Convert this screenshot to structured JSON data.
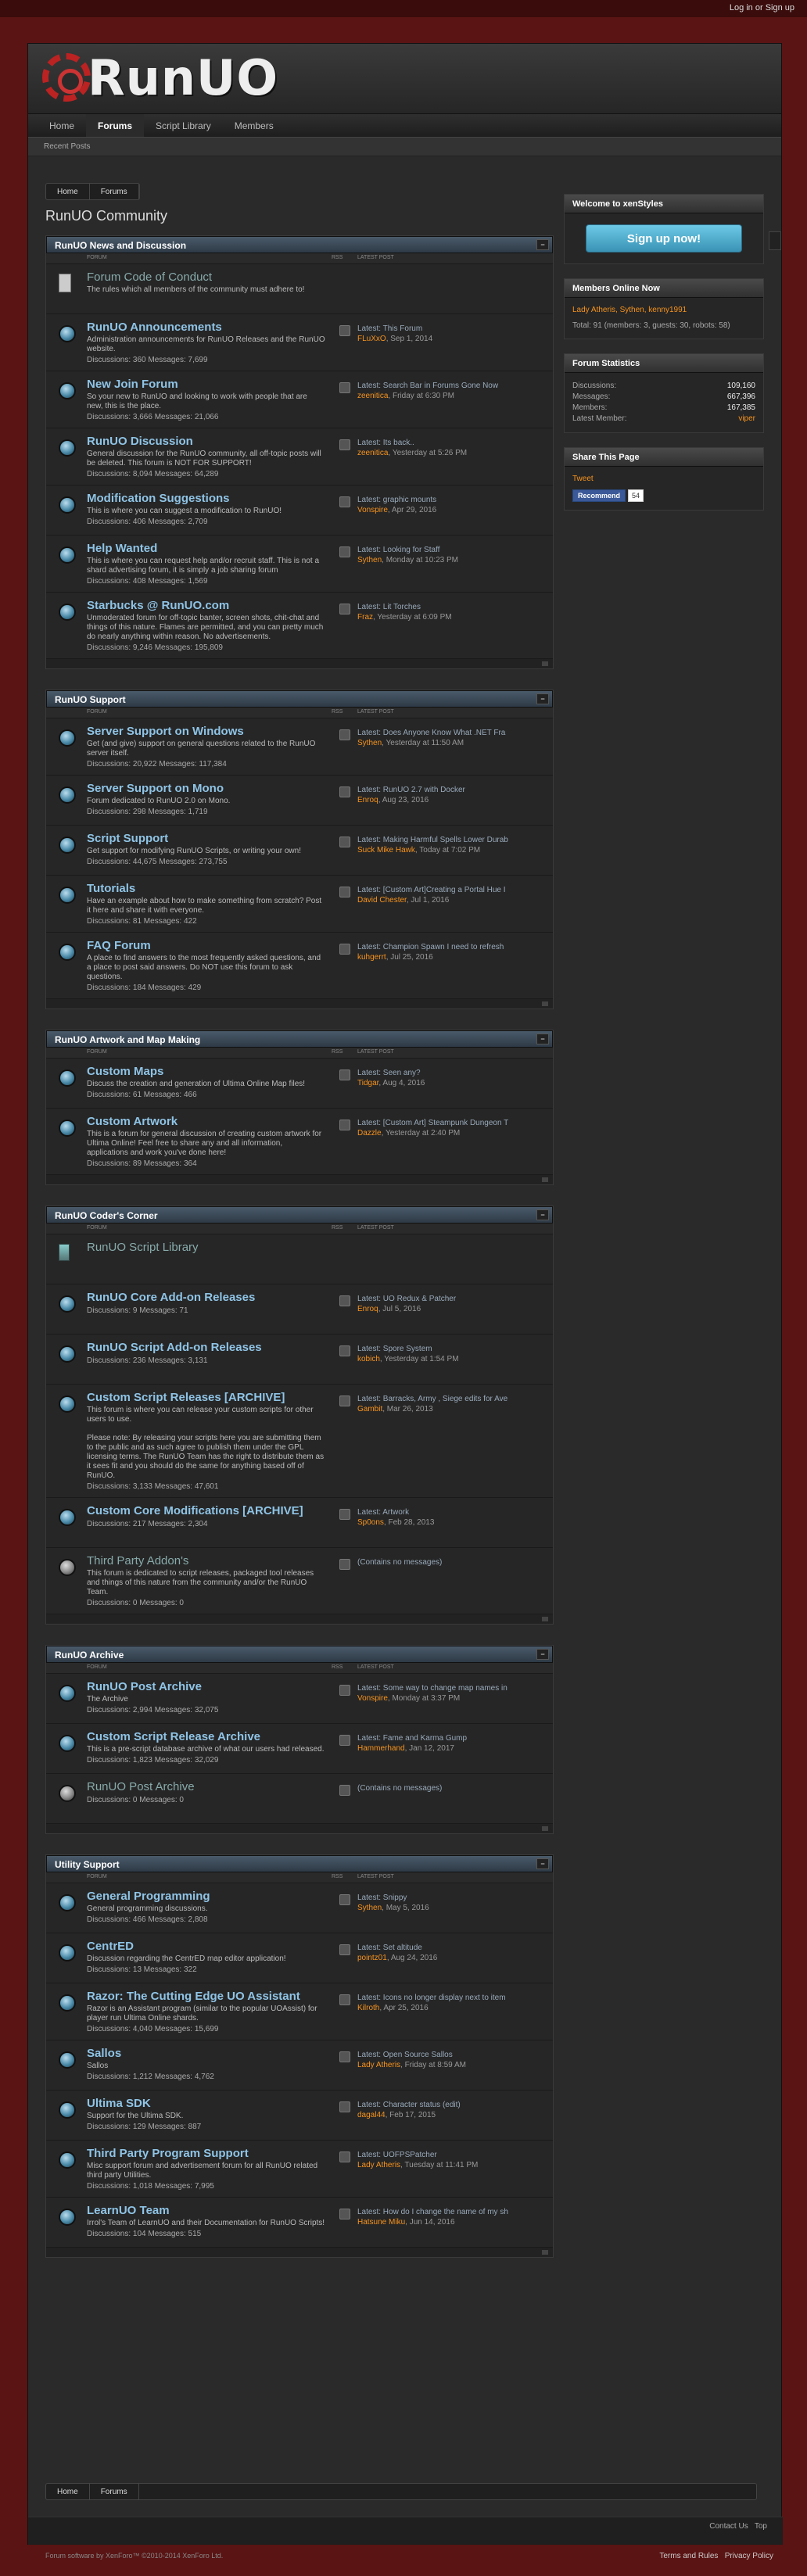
{
  "topbar": {
    "login": "Log in or Sign up"
  },
  "logo": "RunUO",
  "nav": {
    "home": "Home",
    "forums": "Forums",
    "scripts": "Script Library",
    "members": "Members"
  },
  "subnav": "Recent Posts",
  "breadcrumb": {
    "home": "Home",
    "forums": "Forums"
  },
  "page_title": "RunUO Community",
  "col": {
    "forum": "FORUM",
    "rss": "RSS",
    "latest": "LATEST POST"
  },
  "cats": [
    {
      "title": "RunUO News and Discussion",
      "forums": [
        {
          "kind": "doc",
          "name": "Forum Code of Conduct",
          "desc": "The rules which all members of the community must adhere to!",
          "stats": "",
          "latest": "",
          "user": "",
          "time": ""
        },
        {
          "kind": "ic",
          "name": "RunUO Announcements",
          "desc": "Administration announcements for RunUO Releases and the RunUO website.",
          "stats": "Discussions: 360 Messages: 7,699",
          "latest": "Latest: This Forum",
          "user": "FLuXxO",
          "time": ", Sep 1, 2014"
        },
        {
          "kind": "ic",
          "name": "New Join Forum",
          "desc": "So your new to RunUO and looking to work with people that are new, this is the place.",
          "stats": "Discussions: 3,666 Messages: 21,066",
          "latest": "Latest: Search Bar in Forums Gone Now",
          "user": "zeenitica",
          "time": ", Friday at 6:30 PM"
        },
        {
          "kind": "ic",
          "name": "RunUO Discussion",
          "desc": "General discussion for the RunUO community, all off-topic posts will be deleted. This forum is NOT FOR SUPPORT!",
          "stats": "Discussions: 8,094 Messages: 64,289",
          "latest": "Latest: Its back..",
          "user": "zeenitica",
          "time": ", Yesterday at 5:26 PM"
        },
        {
          "kind": "ic",
          "name": "Modification Suggestions",
          "desc": "This is where you can suggest a modification to RunUO!",
          "stats": "Discussions: 406 Messages: 2,709",
          "latest": "Latest: graphic mounts",
          "user": "Vonspire",
          "time": ", Apr 29, 2016"
        },
        {
          "kind": "ic",
          "name": "Help Wanted",
          "desc": "This is where you can request help and/or recruit staff. This is not a shard advertising forum, it is simply a job sharing forum",
          "stats": "Discussions: 408 Messages: 1,569",
          "latest": "Latest: Looking for Staff",
          "user": "Sythen",
          "time": ", Monday at 10:23 PM"
        },
        {
          "kind": "ic",
          "name": "Starbucks @ RunUO.com",
          "desc": "Unmoderated forum for off-topic banter, screen shots, chit-chat and things of this nature. Flames are permitted, and you can pretty much do nearly anything within reason. No advertisements.",
          "stats": "Discussions: 9,246 Messages: 195,809",
          "latest": "Latest: Lit Torches",
          "user": "Fraz",
          "time": ", Yesterday at 6:09 PM"
        }
      ]
    },
    {
      "title": "RunUO Support",
      "forums": [
        {
          "kind": "ic",
          "name": "Server Support on Windows",
          "desc": "Get (and give) support on general questions related to the RunUO server itself.",
          "stats": "Discussions: 20,922 Messages: 117,384",
          "latest": "Latest: Does Anyone Know What .NET Fra",
          "user": "Sythen",
          "time": ", Yesterday at 11:50 AM"
        },
        {
          "kind": "ic",
          "name": "Server Support on Mono",
          "desc": "Forum dedicated to RunUO 2.0 on Mono.",
          "stats": "Discussions: 298 Messages: 1,719",
          "latest": "Latest: RunUO 2.7 with Docker",
          "user": "Enroq",
          "time": ", Aug 23, 2016"
        },
        {
          "kind": "ic",
          "name": "Script Support",
          "desc": "Get support for modifying RunUO Scripts, or writing your own!",
          "stats": "Discussions: 44,675 Messages: 273,755",
          "latest": "Latest: Making Harmful Spells Lower Durab",
          "user": "Suck Mike Hawk",
          "time": ", Today at 7:02 PM"
        },
        {
          "kind": "ic",
          "name": "Tutorials",
          "desc": "Have an example about how to make something from scratch? Post it here and share it with everyone.",
          "stats": "Discussions: 81 Messages: 422",
          "latest": "Latest: [Custom Art]Creating a Portal Hue I",
          "user": "David Chester",
          "time": ", Jul 1, 2016"
        },
        {
          "kind": "ic",
          "name": "FAQ Forum",
          "desc": "A place to find answers to the most frequently asked questions, and a place to post said answers. Do NOT use this forum to ask questions.",
          "stats": "Discussions: 184 Messages: 429",
          "latest": "Latest: Champion Spawn I need to refresh",
          "user": "kuhgerrt",
          "time": ", Jul 25, 2016"
        }
      ]
    },
    {
      "title": "RunUO Artwork and Map Making",
      "forums": [
        {
          "kind": "ic",
          "name": "Custom Maps",
          "desc": "Discuss the creation and generation of Ultima Online Map files!",
          "stats": "Discussions: 61 Messages: 466",
          "latest": "Latest: Seen any?",
          "user": "Tidgar",
          "time": ", Aug 4, 2016"
        },
        {
          "kind": "ic",
          "name": "Custom Artwork",
          "desc": "This is a forum for general discussion of creating custom artwork for Ultima Online! Feel free to share any and all information, applications and work you've done here!",
          "stats": "Discussions: 89 Messages: 364",
          "latest": "Latest: [Custom Art] Steampunk Dungeon T",
          "user": "Dazzle",
          "time": ", Yesterday at 2:40 PM"
        }
      ]
    },
    {
      "title": "RunUO Coder's Corner",
      "forums": [
        {
          "kind": "lnk",
          "name": "RunUO Script Library",
          "desc": "",
          "stats": "",
          "latest": "",
          "user": "",
          "time": ""
        },
        {
          "kind": "ic",
          "name": "RunUO Core Add-on Releases",
          "desc": "",
          "stats": "Discussions: 9 Messages: 71",
          "latest": "Latest: UO Redux & Patcher",
          "user": "Enroq",
          "time": ", Jul 5, 2016"
        },
        {
          "kind": "ic",
          "name": "RunUO Script Add-on Releases",
          "desc": "",
          "stats": "Discussions: 236 Messages: 3,131",
          "latest": "Latest: Spore System",
          "user": "kobich",
          "time": ", Yesterday at 1:54 PM"
        },
        {
          "kind": "ic",
          "name": "Custom Script Releases [ARCHIVE]",
          "desc": "This forum is where you can release your custom scripts for other users to use.\n\nPlease note: By releasing your scripts here you are submitting them to the public and as such agree to publish them under the GPL licensing terms. The RunUO Team has the right to distribute them as it sees fit and you should do the same for anything based off of RunUO.",
          "stats": "Discussions: 3,133 Messages: 47,601",
          "latest": "Latest: Barracks, Army , Siege edits for Ave",
          "user": "Gambit",
          "time": ", Mar 26, 2013"
        },
        {
          "kind": "ic",
          "name": "Custom Core Modifications [ARCHIVE]",
          "desc": "",
          "stats": "Discussions: 217 Messages: 2,304",
          "latest": "Latest: Artwork",
          "user": "Sp0ons",
          "time": ", Feb 28, 2013"
        },
        {
          "kind": "grey",
          "name": "Third Party Addon's",
          "desc": "This forum is dedicated to script releases, packaged tool releases and things of this nature from the community and/or the RunUO Team.",
          "stats": "Discussions: 0 Messages: 0",
          "latest": "(Contains no messages)",
          "user": "",
          "time": ""
        }
      ]
    },
    {
      "title": "RunUO Archive",
      "forums": [
        {
          "kind": "ic",
          "name": "RunUO Post Archive",
          "desc": "The Archive",
          "stats": "Discussions: 2,994 Messages: 32,075",
          "latest": "Latest: Some way to change map names in",
          "user": "Vonspire",
          "time": ", Monday at 3:37 PM"
        },
        {
          "kind": "ic",
          "name": "Custom Script Release Archive",
          "desc": "This is a pre-script database archive of what our users had released.",
          "stats": "Discussions: 1,823 Messages: 32,029",
          "latest": "Latest: Fame and Karma Gump",
          "user": "Hammerhand",
          "time": ", Jan 12, 2017"
        },
        {
          "kind": "grey",
          "name": "RunUO Post Archive",
          "desc": "",
          "stats": "Discussions: 0 Messages: 0",
          "latest": "(Contains no messages)",
          "user": "",
          "time": ""
        }
      ]
    },
    {
      "title": "Utility Support",
      "forums": [
        {
          "kind": "ic",
          "name": "General Programming",
          "desc": "General programming discussions.",
          "stats": "Discussions: 466 Messages: 2,808",
          "latest": "Latest: Snippy",
          "user": "Sythen",
          "time": ", May 5, 2016"
        },
        {
          "kind": "ic",
          "name": "CentrED",
          "desc": "Discussion regarding the CentrED map editor application!",
          "stats": "Discussions: 13 Messages: 322",
          "latest": "Latest: Set altitude",
          "user": "pointz01",
          "time": ", Aug 24, 2016"
        },
        {
          "kind": "ic",
          "name": "Razor: The Cutting Edge UO Assistant",
          "desc": "Razor is an Assistant program (similar to the popular UOAssist) for player run Ultima Online shards.",
          "stats": "Discussions: 4,040 Messages: 15,699",
          "latest": "Latest: Icons no longer display next to item",
          "user": "Kilroth",
          "time": ", Apr 25, 2016"
        },
        {
          "kind": "ic",
          "name": "Sallos",
          "desc": "Sallos",
          "stats": "Discussions: 1,212 Messages: 4,762",
          "latest": "Latest: Open Source Sallos",
          "user": "Lady Atheris",
          "time": ", Friday at 8:59 AM"
        },
        {
          "kind": "ic",
          "name": "Ultima SDK",
          "desc": "Support for the Ultima SDK.",
          "stats": "Discussions: 129 Messages: 887",
          "latest": "Latest: Character status (edit)",
          "user": "dagal44",
          "time": ", Feb 17, 2015"
        },
        {
          "kind": "ic",
          "name": "Third Party Program Support",
          "desc": "Misc support forum and advertisement forum for all RunUO related third party Utilities.",
          "stats": "Discussions: 1,018 Messages: 7,995",
          "latest": "Latest: UOFPSPatcher",
          "user": "Lady Atheris",
          "time": ", Tuesday at 11:41 PM"
        },
        {
          "kind": "ic",
          "name": "LearnUO Team",
          "desc": "Irrol's Team of LearnUO and their Documentation for RunUO Scripts!",
          "stats": "Discussions: 104 Messages: 515",
          "latest": "Latest: How do I change the name of my sh",
          "user": "Hatsune Miku",
          "time": ", Jun 14, 2016"
        }
      ]
    }
  ],
  "sidebar": {
    "welcome": {
      "title": "Welcome to xenStyles",
      "button": "Sign up now!"
    },
    "online": {
      "title": "Members Online Now",
      "users": "Lady Atheris, Sythen, kenny1991",
      "meta": "Total: 91 (members: 3, guests: 30, robots: 58)"
    },
    "stats": {
      "title": "Forum Statistics",
      "rows": [
        [
          "Discussions:",
          "109,160"
        ],
        [
          "Messages:",
          "667,396"
        ],
        [
          "Members:",
          "167,385"
        ],
        [
          "Latest Member:",
          "viper"
        ]
      ]
    },
    "share": {
      "title": "Share This Page",
      "tweet": "Tweet",
      "fb": "Recommend",
      "fbcount": "54"
    }
  },
  "footer": {
    "contact": "Contact Us",
    "top": "Top",
    "copy": "Forum software by XenForo™ ©2010-2014 XenForo Ltd.",
    "terms": "Terms and Rules",
    "privacy": "Privacy Policy"
  }
}
